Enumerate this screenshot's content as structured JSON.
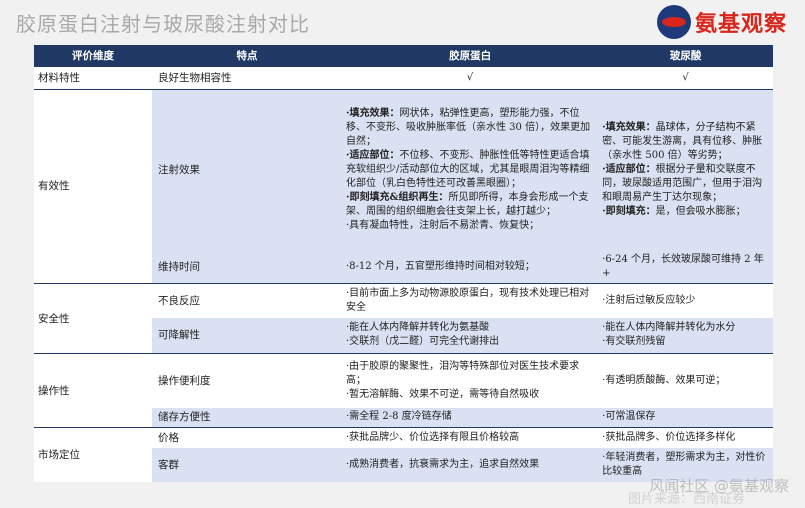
{
  "page_title": "胶原蛋白注射与玻尿酸注射对比",
  "logo": {
    "text": "氨基观察"
  },
  "table": {
    "headers": [
      "评价维度",
      "特点",
      "胶原蛋白",
      "玻尿酸"
    ],
    "rows": {
      "material": {
        "dim": "材料特性",
        "attr": "良好生物相容性",
        "collagen": "√",
        "ha": "√"
      },
      "efficacy_dim": "有效性",
      "injection": {
        "attr": "注射效果",
        "collagen": {
          "p1_label": "·填充效果：",
          "p1_text": "网状体，粘弹性更高，塑形能力强，不位移、不变形、吸收肿胀率低（亲水性 30 倍），效果更加自然；",
          "p2_label": "·适应部位：",
          "p2_text": "不位移、不变形、肿胀性低等特性更适合填充软组织少/活动部位大的区域，尤其是眼周泪沟等精细化部位（乳白色特性还可改善黑眼圈）；",
          "p3_label": "·即刻填充&组织再生：",
          "p3_text": "所见即所得，本身会形成一个支架、周围的组织细胞会往支架上长，越打越少；",
          "p4_text": "·具有凝血特性，注射后不易淤青、恢复快；"
        },
        "ha": {
          "p1_label": "·填充效果：",
          "p1_text": "晶球体，分子结构不紧密、可能发生游离，具有位移、肿胀（亲水性 500 倍）等劣势；",
          "p2_label": "·适应部位：",
          "p2_text": "根据分子量和交联度不同，玻尿酸适用范围广，但用于泪沟和眼周易产生丁达尔现象；",
          "p3_label": "·即刻填充：",
          "p3_text": "是，但会吸水膨胀；"
        }
      },
      "duration": {
        "attr": "维持时间",
        "collagen": "·8-12 个月，五官塑形维持时间相对较短；",
        "ha": "·6-24 个月，长效玻尿酸可维持 2 年+"
      },
      "safety_dim": "安全性",
      "adverse": {
        "attr": "不良反应",
        "collagen": "·目前市面上多为动物源胶原蛋白，现有技术处理已相对安全",
        "ha": "·注射后过敏反应较少"
      },
      "degradable": {
        "attr": "可降解性",
        "collagen_1": "·能在人体内降解并转化为氨基酸",
        "collagen_2": "·交联剂（戊二醛）可完全代谢排出",
        "ha_1": "·能在人体内降解并转化为水分",
        "ha_2": "·有交联剂残留"
      },
      "operation_dim": "操作性",
      "convenience": {
        "attr": "操作便利度",
        "collagen_1": "·由于胶原的聚聚性，泪沟等特殊部位对医生技术要求高；",
        "collagen_2": "·暂无溶解酶、效果不可逆，需等待自然吸收",
        "ha": "·有透明质酸酶、效果可逆；"
      },
      "storage": {
        "attr": "储存方便性",
        "collagen": "·需全程 2-8 度冷链存储",
        "ha": "·可常温保存"
      },
      "market_dim": "市场定位",
      "price": {
        "attr": "价格",
        "collagen": "·获批品牌少、价位选择有限且价格较高",
        "ha": "·获批品牌多、价位选择多样化"
      },
      "customer": {
        "attr": "客群",
        "collagen": "·成熟消费者，抗衰需求为主，追求自然效果",
        "ha": "·年轻消费者，塑形需求为主，对性价比较重高"
      }
    }
  },
  "watermark": {
    "line1": "图片来源：西南证券",
    "line2": "风闻社区 @氨基观察"
  }
}
